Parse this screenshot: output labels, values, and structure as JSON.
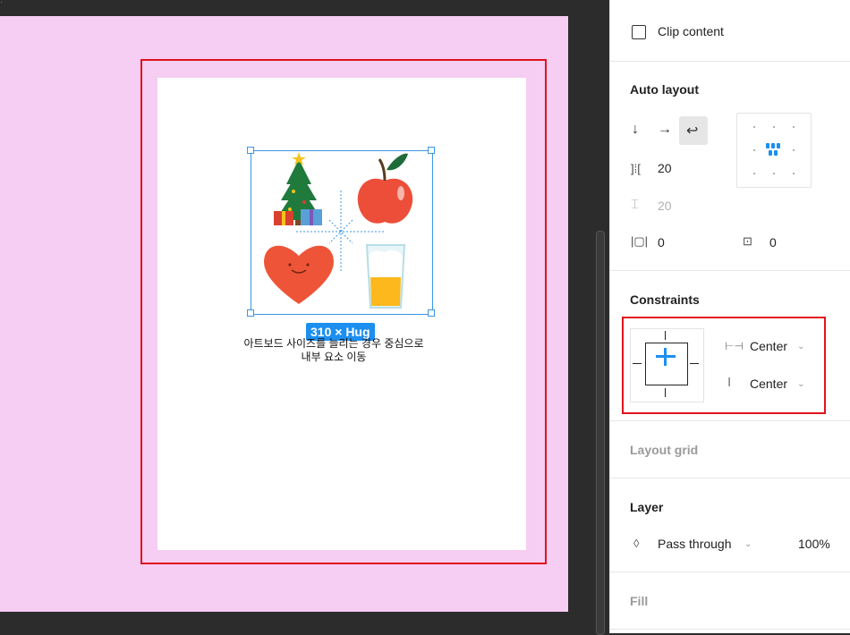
{
  "canvas": {
    "size_badge": "310 × Hug",
    "caption_line1": "아트보드 사이즈를 늘리는 경우 중심으로",
    "caption_line2": "내부 요소 이동",
    "colors": {
      "artboard": "#f6cdf3",
      "highlight": "#e0141c",
      "selection": "#3b95e6"
    }
  },
  "panel": {
    "clip_content": {
      "label": "Clip content",
      "checked": false
    },
    "auto_layout": {
      "title": "Auto layout",
      "direction_icons": [
        "arrow-down-icon",
        "arrow-right-icon",
        "wrap-icon"
      ],
      "spacing_between": "20",
      "spacing_rows": "20",
      "padding_horizontal": "0",
      "padding_vertical": "0",
      "alignment": "center"
    },
    "constraints": {
      "title": "Constraints",
      "horizontal": "Center",
      "vertical": "Center"
    },
    "layout_grid": {
      "title": "Layout grid"
    },
    "layer": {
      "title": "Layer",
      "blend_mode": "Pass through",
      "opacity": "100%"
    },
    "fill": {
      "title": "Fill"
    }
  }
}
